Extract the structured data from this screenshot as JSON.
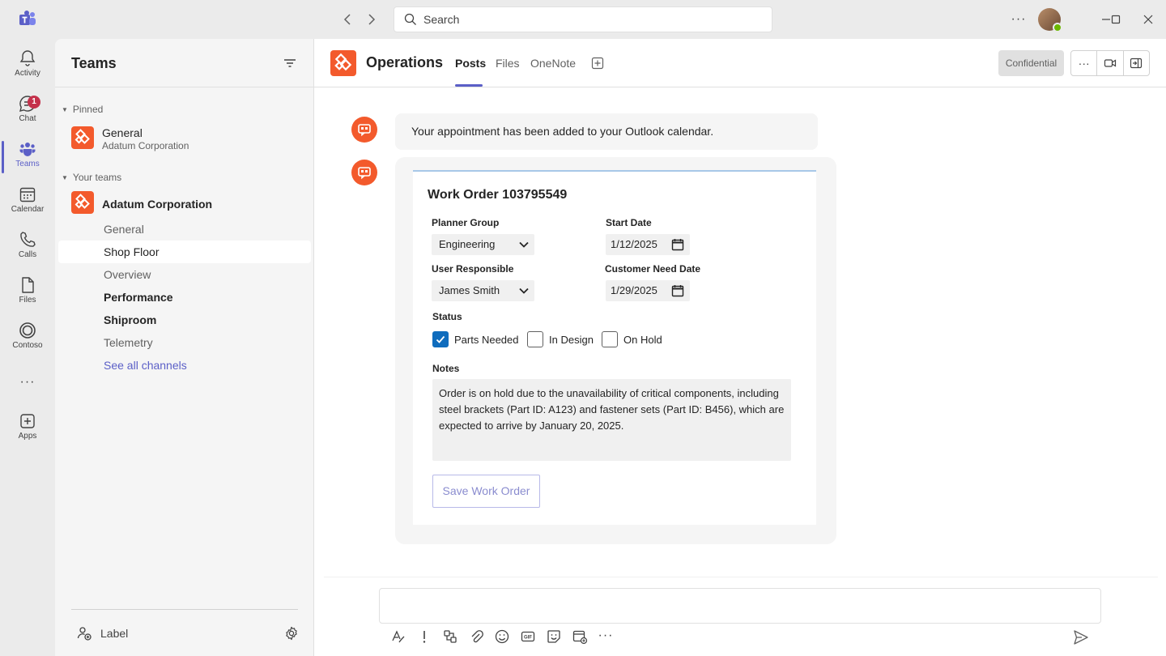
{
  "titlebar": {
    "search_placeholder": "Search",
    "more": "···"
  },
  "rail": {
    "items": [
      {
        "label": "Activity",
        "icon": "bell-icon"
      },
      {
        "label": "Chat",
        "icon": "chat-icon",
        "badge": "1"
      },
      {
        "label": "Teams",
        "icon": "teams-icon"
      },
      {
        "label": "Calendar",
        "icon": "calendar-icon"
      },
      {
        "label": "Calls",
        "icon": "phone-icon"
      },
      {
        "label": "Files",
        "icon": "file-icon"
      },
      {
        "label": "Contoso",
        "icon": "contoso-icon"
      },
      {
        "label": "",
        "icon": "more-icon"
      },
      {
        "label": "Apps",
        "icon": "add-app-icon"
      }
    ],
    "active": "Teams",
    "more": "···"
  },
  "teams_pane": {
    "title": "Teams",
    "pinned_label": "Pinned",
    "pinned": {
      "name": "General",
      "team": "Adatum Corporation"
    },
    "your_teams_label": "Your teams",
    "team": {
      "name": "Adatum Corporation",
      "channels": [
        {
          "name": "General",
          "style": "normal"
        },
        {
          "name": "Shop Floor",
          "style": "selected"
        },
        {
          "name": "Overview",
          "style": "normal"
        },
        {
          "name": "Performance",
          "style": "bold"
        },
        {
          "name": "Shiproom",
          "style": "bold"
        },
        {
          "name": "Telemetry",
          "style": "normal"
        }
      ],
      "see_all": "See all channels"
    },
    "footer_label": "Label"
  },
  "channel": {
    "name": "Operations",
    "tabs": [
      "Posts",
      "Files",
      "OneNote"
    ],
    "active_tab": "Posts",
    "sensitivity": "Confidential",
    "more": "···"
  },
  "messages": {
    "notice": "Your appointment has been added to your Outlook calendar."
  },
  "work_order": {
    "title": "Work Order 103795549",
    "planner_group_label": "Planner Group",
    "planner_group_value": "Engineering",
    "start_date_label": "Start Date",
    "start_date_value": "1/12/2025",
    "user_responsible_label": "User Responsible",
    "user_responsible_value": "James Smith",
    "customer_need_date_label": "Customer Need Date",
    "customer_need_date_value": "1/29/2025",
    "status_label": "Status",
    "status_options": [
      {
        "label": "Parts Needed",
        "checked": true
      },
      {
        "label": "In Design",
        "checked": false
      },
      {
        "label": "On Hold",
        "checked": false
      }
    ],
    "notes_label": "Notes",
    "notes_value": "Order is on hold due to the unavailability of critical components, including steel brackets (Part ID: A123) and fastener sets (Part ID: B456), which are expected to arrive by January 20, 2025.",
    "save_label": "Save Work Order"
  },
  "colors": {
    "accent": "#5b5fc7",
    "brand_orange": "#f35a2c",
    "checkbox_blue": "#0f6cbd",
    "badge_red": "#c4314b"
  }
}
